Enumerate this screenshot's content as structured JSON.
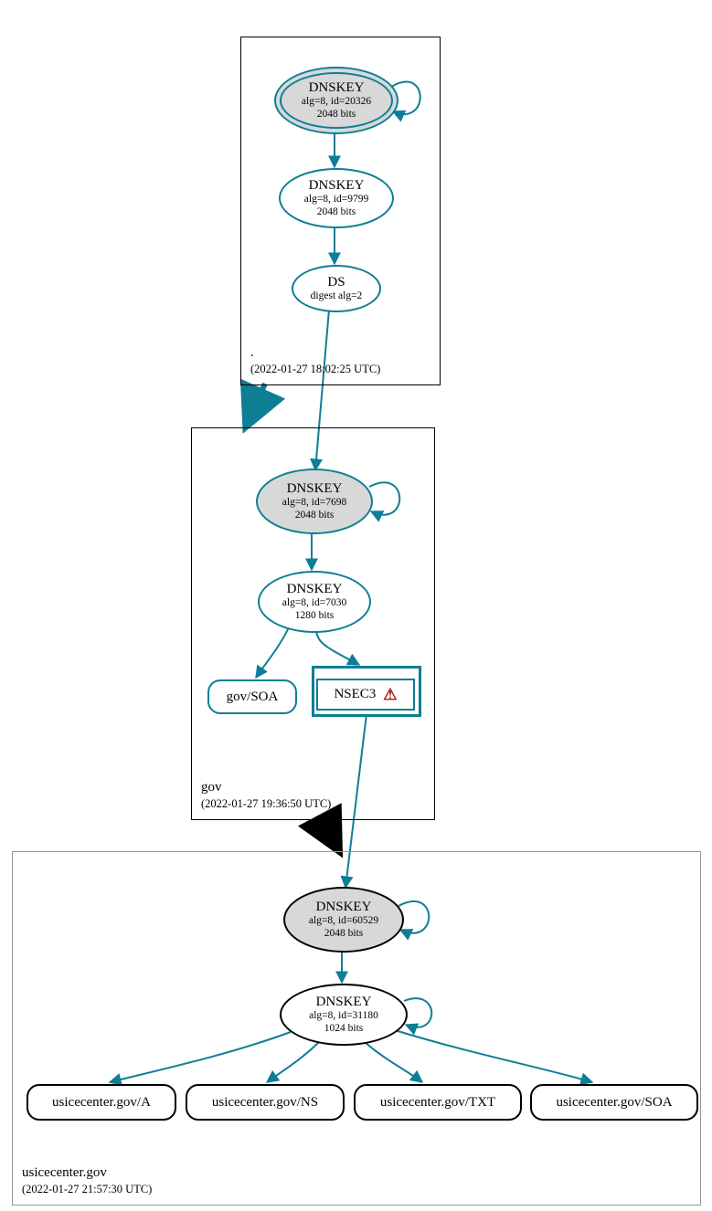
{
  "colors": {
    "teal": "#0e7e95",
    "grey_fill": "#d8d8d8",
    "light_border": "#969696",
    "warn": "#b01414"
  },
  "zones": {
    "root": {
      "name": ".",
      "timestamp": "(2022-01-27 18:02:25 UTC)"
    },
    "gov": {
      "name": "gov",
      "timestamp": "(2022-01-27 19:36:50 UTC)"
    },
    "leaf": {
      "name": "usicecenter.gov",
      "timestamp": "(2022-01-27 21:57:30 UTC)"
    }
  },
  "nodes": {
    "root_ksk": {
      "title": "DNSKEY",
      "sub1": "alg=8, id=20326",
      "sub2": "2048 bits"
    },
    "root_zsk": {
      "title": "DNSKEY",
      "sub1": "alg=8, id=9799",
      "sub2": "2048 bits"
    },
    "root_ds": {
      "title": "DS",
      "sub1": "digest alg=2"
    },
    "gov_ksk": {
      "title": "DNSKEY",
      "sub1": "alg=8, id=7698",
      "sub2": "2048 bits"
    },
    "gov_zsk": {
      "title": "DNSKEY",
      "sub1": "alg=8, id=7030",
      "sub2": "1280 bits"
    },
    "gov_soa": {
      "label": "gov/SOA"
    },
    "gov_nsec": {
      "label": "NSEC3",
      "warn_glyph": "⚠"
    },
    "leaf_ksk": {
      "title": "DNSKEY",
      "sub1": "alg=8, id=60529",
      "sub2": "2048 bits"
    },
    "leaf_zsk": {
      "title": "DNSKEY",
      "sub1": "alg=8, id=31180",
      "sub2": "1024 bits"
    },
    "leaf_a": {
      "label": "usicecenter.gov/A"
    },
    "leaf_ns": {
      "label": "usicecenter.gov/NS"
    },
    "leaf_txt": {
      "label": "usicecenter.gov/TXT"
    },
    "leaf_soa": {
      "label": "usicecenter.gov/SOA"
    }
  }
}
